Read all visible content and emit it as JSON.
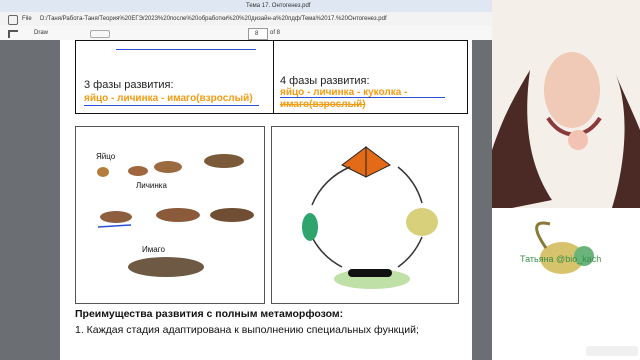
{
  "window": {
    "title": "Тема 17. Онтогенез.pdf"
  },
  "browser": {
    "file_label": "File",
    "path": "D:/Таня/Работа-Таня/Теория%20ЕГЭ/2023%20после%20обработки%20%20дизайн-а%20пдф/Тема%2017.%20Онтогенез.pdf"
  },
  "toolbar": {
    "draw_label": "Draw",
    "page_value": "8",
    "page_total": "of 8"
  },
  "table": {
    "left_heading": "3 фазы развития:",
    "left_phases": "яйцо - личинка - имаго(взрослый)",
    "right_heading": "4 фазы развития:",
    "right_phases": "яйцо - личинка - куколка -",
    "right_phases_2": "имаго(взрослый)"
  },
  "left_figure": {
    "egg": "Яйцо",
    "larva": "Личинка",
    "adult": "Имаго"
  },
  "advantages": {
    "title": "Преимущества развития с полным метаморфозом:",
    "item1": "1. Каждая стадия адаптирована к выполнению специальных функций;"
  },
  "overlay": {
    "channel_label": "Татьяна @bio_kach"
  }
}
